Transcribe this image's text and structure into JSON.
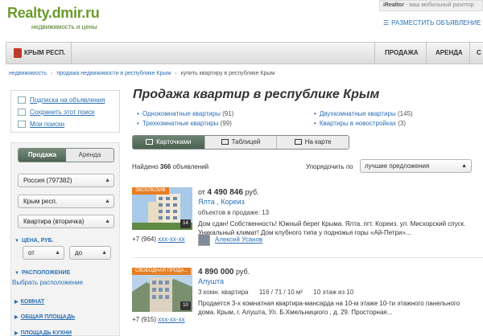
{
  "header": {
    "logo": "Realty.dmir.ru",
    "tagline": "недвижимость и цены",
    "irealtor": "iRealtor",
    "irealtor_tail": " - ваш мобильный риэлтор",
    "place_ad": "РАЗМЕСТИТЬ ОБЪЯВЛЕНИЕ"
  },
  "navbar": {
    "region": "КРЫМ РЕСП.",
    "items": [
      "ПРОДАЖА",
      "АРЕНДА",
      "С"
    ]
  },
  "breadcrumb": {
    "items": [
      "недвижимость",
      "продажа недвижимости в республике Крым",
      "купить квартиру в республике Крым"
    ]
  },
  "left_panel": {
    "subscribe": "Подписка на объявления",
    "save_search": "Сохранить этот поиск",
    "my_searches": "Мои поиски"
  },
  "filters": {
    "tab_sale": "Продажа",
    "tab_rent": "Аренда",
    "country": "Россия (797382)",
    "region": "Крым респ.",
    "type": "Квартира (вторичка)",
    "price_label": "ЦЕНА, РУБ.",
    "price_from": "от",
    "price_to": "до",
    "location_label": "РАСПОЛОЖЕНИЕ",
    "choose_location": "Выбрать расположение",
    "rooms_label": "КОМНАТ",
    "total_area_label": "ОБЩАЯ ПЛОЩАДЬ",
    "kitchen_area_label": "ПЛОЩАДЬ КУХНИ"
  },
  "main": {
    "title": "Продажа квартир в республике Крым",
    "categories": [
      {
        "label": "Однокомнатные квартиры",
        "count": "(91)"
      },
      {
        "label": "Трехкомнатные квартиры",
        "count": "(99)"
      },
      {
        "label": "Двухкомнатные квартиры",
        "count": "(145)"
      },
      {
        "label": "Квартиры в новостройках",
        "count": "(3)"
      }
    ],
    "view_tabs": [
      "Карточками",
      "Таблицей",
      "На карте"
    ],
    "found_prefix": "Найдено ",
    "found_count": "366",
    "found_suffix": " объявлений",
    "sort_label": "Упорядочить по",
    "sort_value": "лучшие предложения"
  },
  "listings": [
    {
      "badge": "ЭКСКЛЮЗИВ",
      "badge_color": "#e67e22",
      "photo_count": "14",
      "price_prefix": "от ",
      "price": "4 490 846",
      "currency": " руб.",
      "city": "Ялта , Кореиз",
      "meta": "объектов в продаже: 13",
      "description": "Дом сдан! Собственность! Южный берег Крыма. Ялта. пгт. Кореиз. ул. Мисхорский спуск. Уникальный климат! Дом клубного типа у подножья горы «Ай-Петри»...",
      "phone": "+7 (964) ",
      "phone_hidden": "ххх-хх-хх",
      "agent": "Алексей Усанов"
    },
    {
      "badge": "СВОБОДНАЯ ПРОДА...",
      "badge_color": "#e67e22",
      "photo_count": "10",
      "price_prefix": "",
      "price": "4 890 000",
      "currency": " руб.",
      "city": "Алушта",
      "meta": "3 комн. квартира      116 / 71 / 10 м²      10 этаж из 10",
      "description": "Продается 3-х комнатная квартира-мансарда на 10-м этаже 10-ти этажного панельного дома. Крым, г. Алушта, Ул. Б.Хмельницкого , д. 29. Просторная...",
      "phone": "+7 (915) ",
      "phone_hidden": "ххх-хх-хх"
    }
  ]
}
